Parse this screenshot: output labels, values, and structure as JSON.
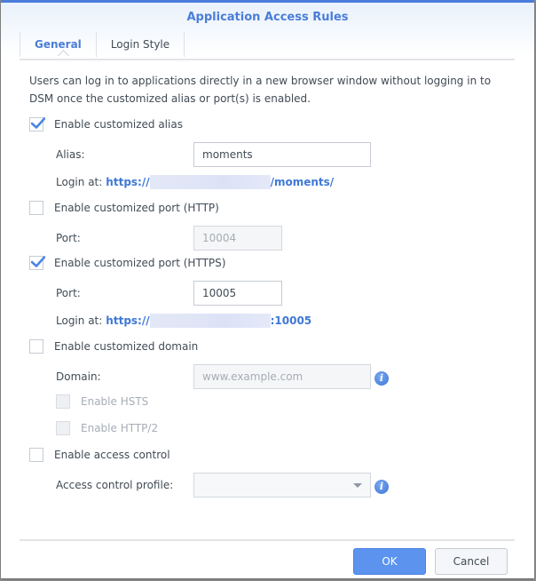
{
  "dialog": {
    "title": "Application Access Rules",
    "tabs": [
      {
        "label": "General",
        "active": true
      },
      {
        "label": "Login Style",
        "active": false
      }
    ],
    "description": "Users can log in to applications directly in a new browser window without logging in to DSM once the customized alias or port(s) is enabled."
  },
  "alias": {
    "checkbox_label": "Enable customized alias",
    "checked": true,
    "field_label": "Alias:",
    "value": "moments",
    "login_label": "Login at:",
    "login_prefix": "https://",
    "login_suffix": "/moments/"
  },
  "http_port": {
    "checkbox_label": "Enable customized port (HTTP)",
    "checked": false,
    "field_label": "Port:",
    "value": "10004"
  },
  "https_port": {
    "checkbox_label": "Enable customized port (HTTPS)",
    "checked": true,
    "field_label": "Port:",
    "value": "10005",
    "login_label": "Login at:",
    "login_prefix": "https://",
    "login_suffix": ":10005"
  },
  "domain": {
    "checkbox_label": "Enable customized domain",
    "checked": false,
    "field_label": "Domain:",
    "placeholder": "www.example.com",
    "hsts_label": "Enable HSTS",
    "http2_label": "Enable HTTP/2",
    "info_icon": "i"
  },
  "access_control": {
    "checkbox_label": "Enable access control",
    "checked": false,
    "field_label": "Access control profile:",
    "selected": "",
    "info_icon": "i"
  },
  "footer": {
    "ok_label": "OK",
    "cancel_label": "Cancel"
  },
  "colors": {
    "accent": "#4a7dd8",
    "ok_button": "#5b93ee",
    "link": "#3f78d6"
  }
}
